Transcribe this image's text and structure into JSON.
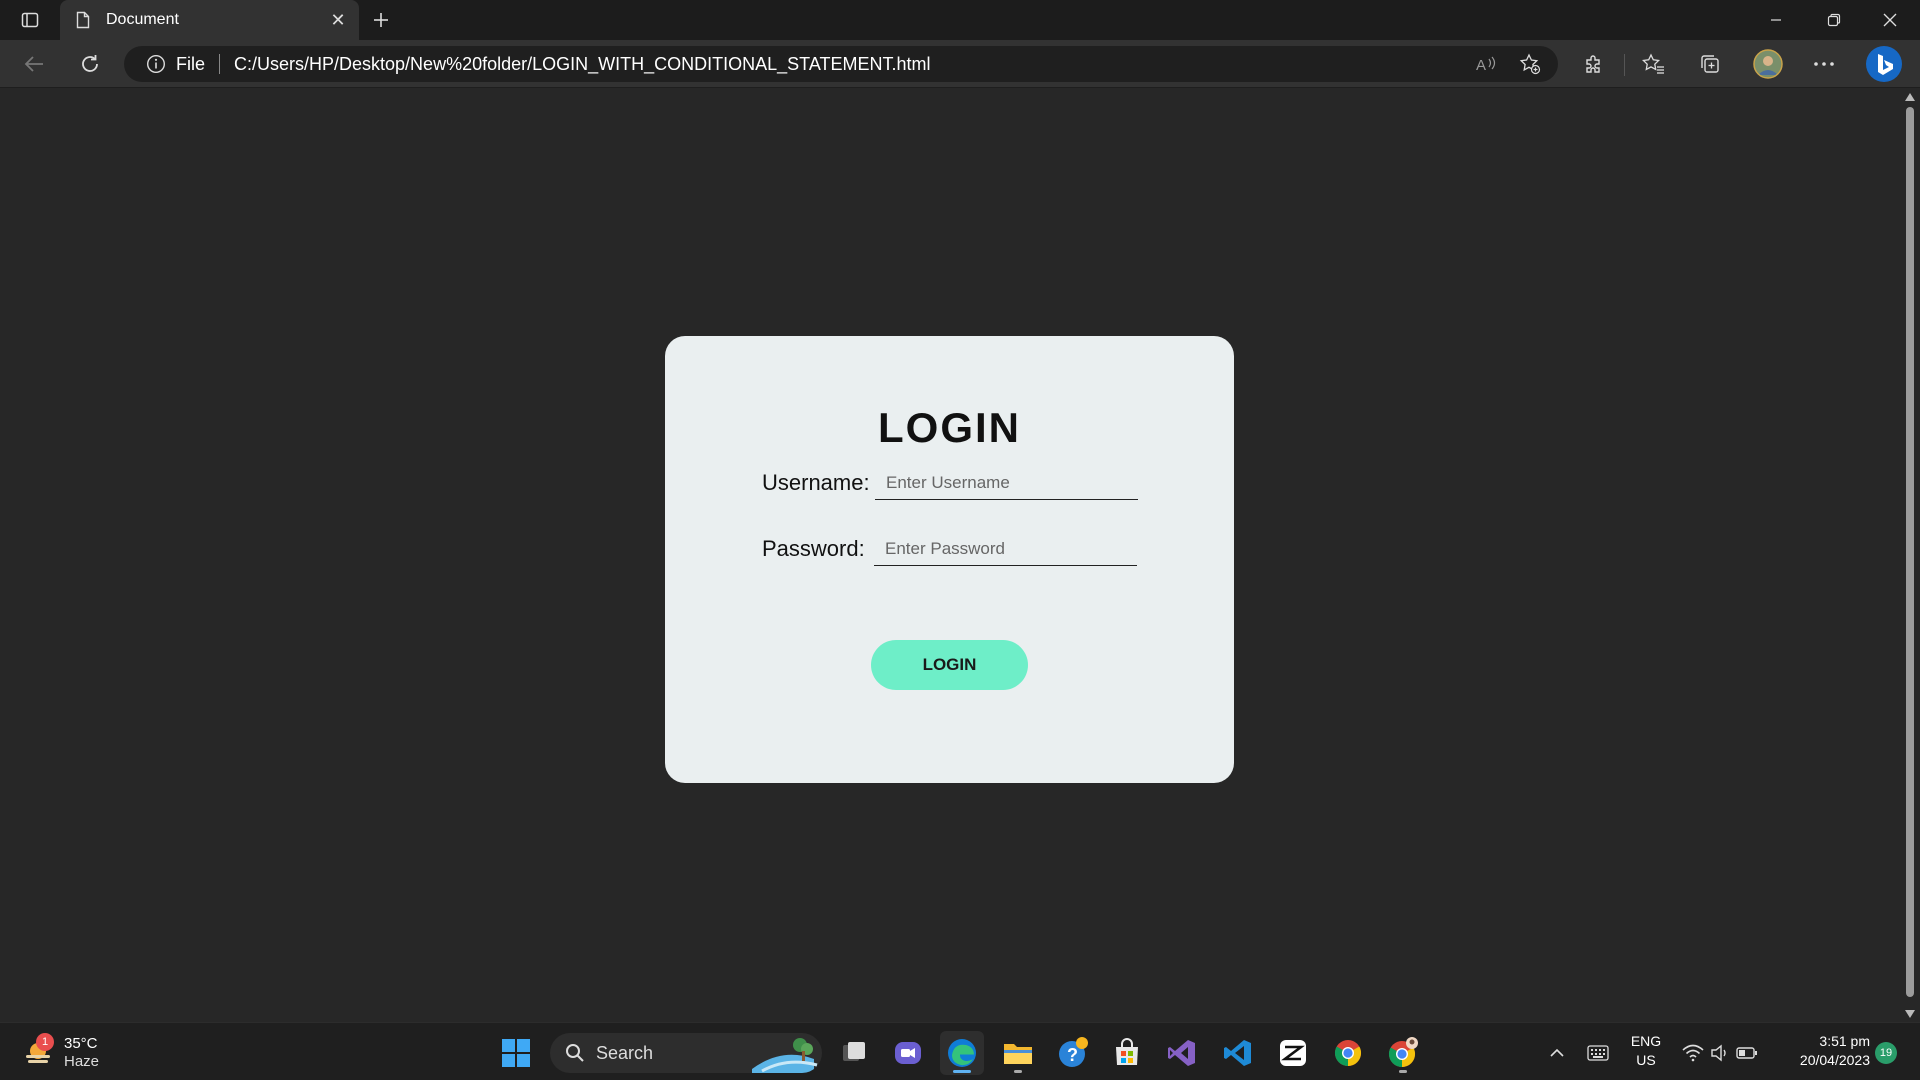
{
  "browser": {
    "tab": {
      "title": "Document"
    },
    "address": {
      "scheme_label": "File",
      "url": "C:/Users/HP/Desktop/New%20folder/LOGIN_WITH_CONDITIONAL_STATEMENT.html"
    }
  },
  "login": {
    "title": "LOGIN",
    "username_label": "Username:",
    "username_placeholder": "Enter Username",
    "username_value": "",
    "password_label": "Password:",
    "password_placeholder": "Enter Password",
    "password_value": "",
    "button_label": "LOGIN"
  },
  "taskbar": {
    "weather": {
      "temp": "35°C",
      "condition": "Haze",
      "badge": "1"
    },
    "search_label": "Search",
    "language": {
      "line1": "ENG",
      "line2": "US"
    },
    "clock": {
      "time": "3:51 pm",
      "date": "20/04/2023"
    },
    "notification_count": "19"
  },
  "colors": {
    "page_bg": "#272727",
    "card_bg": "#eaeff0",
    "button_bg": "#6eeec8",
    "chrome_bg": "#323232"
  }
}
